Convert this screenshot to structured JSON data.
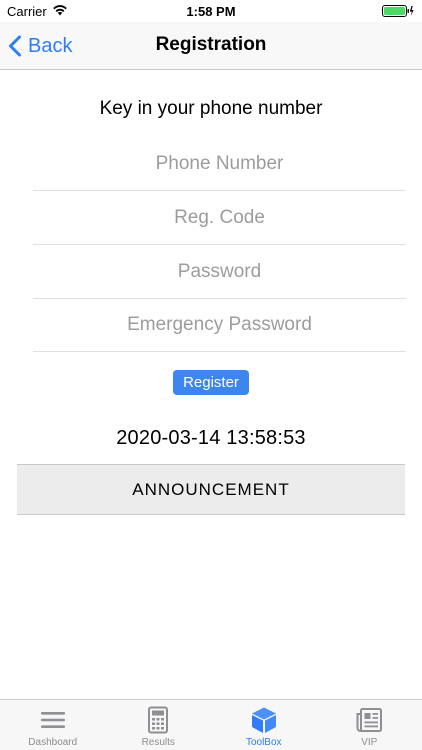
{
  "status_bar": {
    "carrier": "Carrier",
    "time": "1:58 PM"
  },
  "nav": {
    "back_label": "Back",
    "title": "Registration"
  },
  "form": {
    "prompt": "Key in your phone number",
    "phone_placeholder": "Phone Number",
    "reg_code_placeholder": "Reg. Code",
    "password_placeholder": "Password",
    "emergency_password_placeholder": "Emergency Password",
    "register_label": "Register"
  },
  "datetime": "2020-03-14 13:58:53",
  "announcement_label": "ANNOUNCEMENT",
  "tabs": [
    {
      "label": "Dashboard",
      "icon": "menu-icon",
      "active": false
    },
    {
      "label": "Results",
      "icon": "calculator-icon",
      "active": false
    },
    {
      "label": "ToolBox",
      "icon": "cube-icon",
      "active": true
    },
    {
      "label": "VIP",
      "icon": "newspaper-icon",
      "active": false
    }
  ],
  "colors": {
    "accent": "#2f7cf6",
    "register_button": "#3d86ee",
    "battery": "#4cd964",
    "announcement_bg": "#ececec"
  }
}
